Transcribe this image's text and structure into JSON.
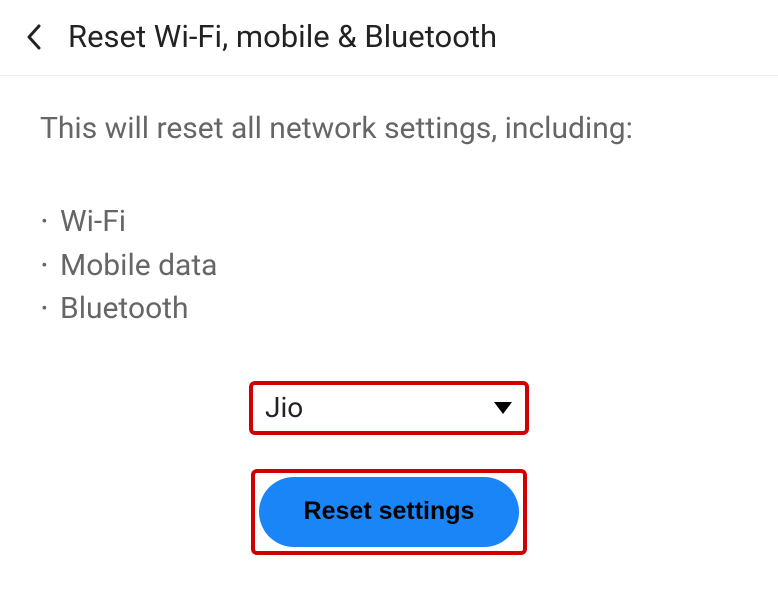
{
  "header": {
    "title": "Reset Wi-Fi, mobile & Bluetooth"
  },
  "main": {
    "description": "This will reset all network settings, including:",
    "items": [
      "Wi-Fi",
      "Mobile data",
      "Bluetooth"
    ],
    "dropdown": {
      "selected": "Jio"
    },
    "button": {
      "label": "Reset settings"
    }
  }
}
